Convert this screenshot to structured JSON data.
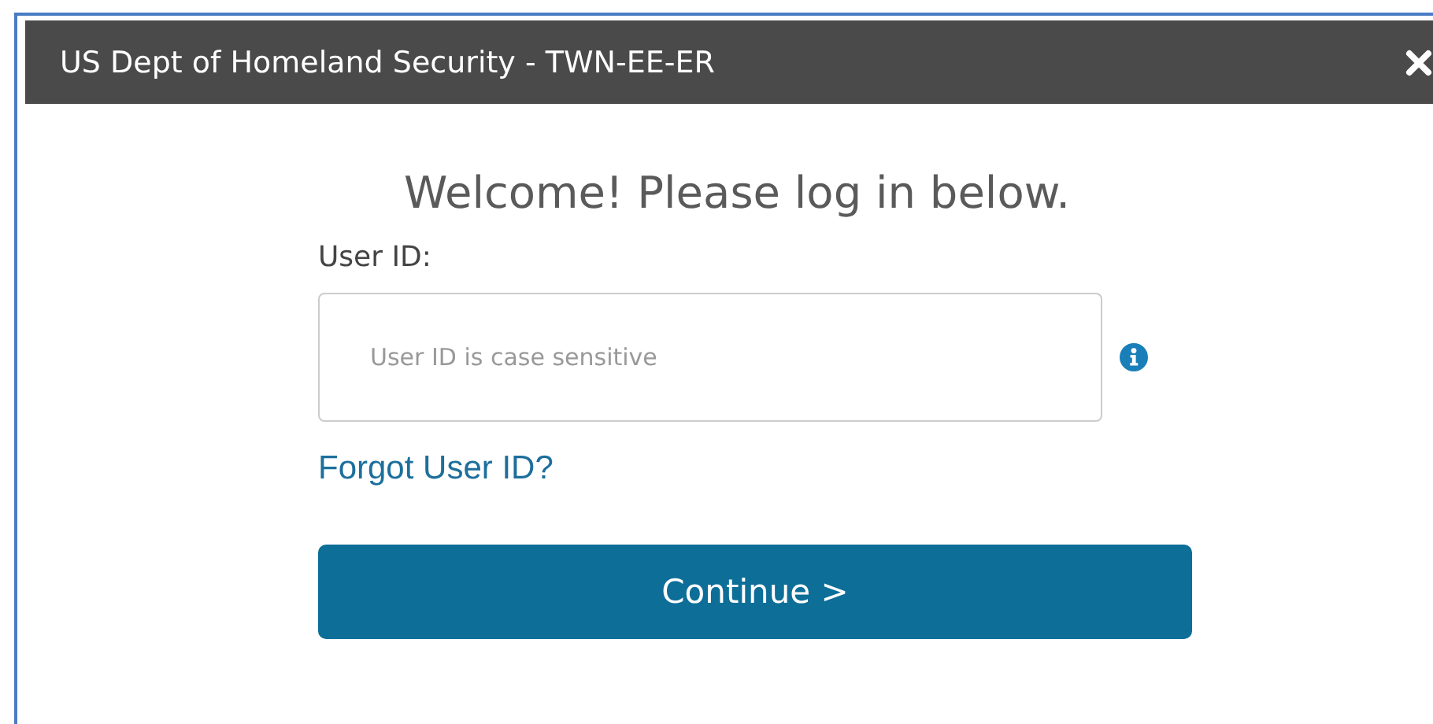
{
  "window": {
    "title": "US Dept of Homeland Security - TWN-EE-ER"
  },
  "heading": "Welcome! Please log in below.",
  "user_id": {
    "label": "User ID:",
    "placeholder": "User ID is case sensitive"
  },
  "forgot_link": "Forgot User ID?",
  "continue_button": "Continue >"
}
